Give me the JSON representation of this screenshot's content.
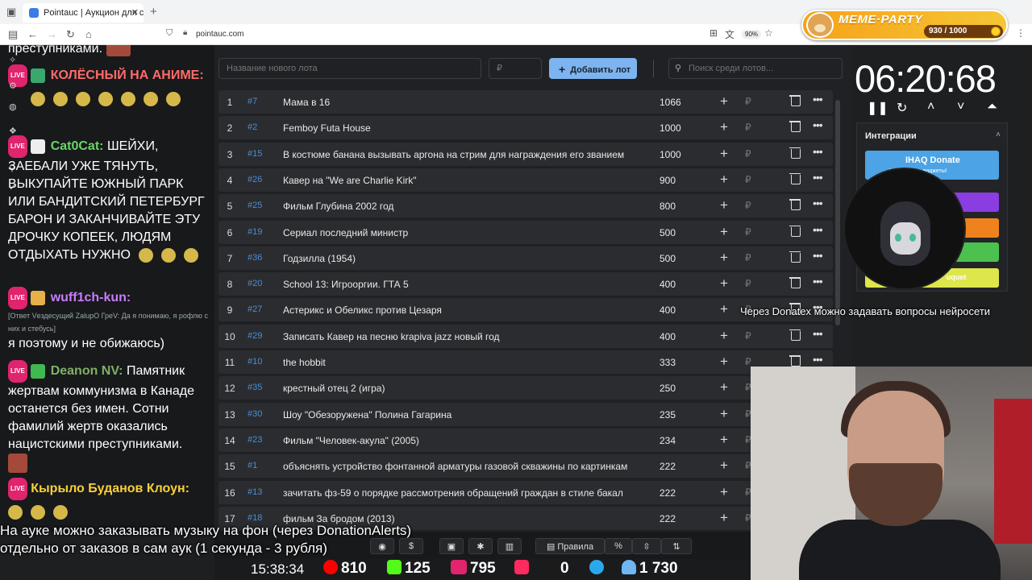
{
  "browser": {
    "tab_title": "Pointauc | Аукцион для стрим",
    "url": "pointauc.com",
    "zoom": "90%"
  },
  "meme_party": {
    "title": "MEME·PARTY",
    "progress": "930 / 1000"
  },
  "chat": {
    "messages": [
      {
        "text": "преступниками."
      },
      {
        "nick": "КОЛЁСНЫЙ НА АНИМЕ:",
        "nick_color": "#ff6b6b"
      },
      {
        "nick": "Cat0Cat:",
        "nick_color": "#6bd36b",
        "text": "ШЕЙХИ, ЗАЕБАЛИ УЖЕ ТЯНУТЬ, ВЫКУПАЙТЕ ЮЖНЫЙ ПАРК ИЛИ БАНДИТСКИЙ ПЕТЕРБУРГ БАРОН И ЗАКАНЧИВАЙТЕ ЭТУ ДРОЧКУ КОПЕЕК, ЛЮДЯМ ОТДЫХАТЬ НУЖНО"
      },
      {
        "nick": "wuff1ch-kun:",
        "nick_color": "#c77dff",
        "reply": "[Ответ Vездесущий ZalupО ГреV: Да я понимаю, я рофлю с них и стебусь]",
        "text": "я поэтому и не обижаюсь)"
      },
      {
        "nick": "Deanon NV:",
        "nick_color": "#7fb069",
        "text": "Памятник жертвам коммунизма в Канаде останется без имен. Сотни фамилий жертв оказались нацистскими преступниками."
      },
      {
        "nick": "Кырыло Буданов Клоун:",
        "nick_color": "#f7d038"
      }
    ],
    "live_label": "LIVE"
  },
  "lots": {
    "new_lot_placeholder": "Название нового лота",
    "amount_placeholder": "₽",
    "add_button": "Добавить лот",
    "search_placeholder": "Поиск среди лотов...",
    "currency": "₽",
    "rows": [
      {
        "n": "1",
        "id": "#7",
        "name": "Мама в 16",
        "amount": "1066"
      },
      {
        "n": "2",
        "id": "#2",
        "name": "Femboy Futa House",
        "amount": "1000"
      },
      {
        "n": "3",
        "id": "#15",
        "name": "В костюме банана вызывать аргона на стрим для награждения его званием",
        "amount": "1000"
      },
      {
        "n": "4",
        "id": "#26",
        "name": "Кавер на \"We are Charlie Kirk\"",
        "amount": "900"
      },
      {
        "n": "5",
        "id": "#25",
        "name": "Фильм Глубина 2002 год",
        "amount": "800"
      },
      {
        "n": "6",
        "id": "#19",
        "name": "Сериал последний министр",
        "amount": "500"
      },
      {
        "n": "7",
        "id": "#36",
        "name": "Годзилла (1954)",
        "amount": "500"
      },
      {
        "n": "8",
        "id": "#20",
        "name": "School 13: Игрооргии. ГТА 5",
        "amount": "400"
      },
      {
        "n": "9",
        "id": "#27",
        "name": "Астерикс и Обеликс против Цезаря",
        "amount": "400"
      },
      {
        "n": "10",
        "id": "#29",
        "name": "Записать Кавер на песню krapiva jazz новый год",
        "amount": "400"
      },
      {
        "n": "11",
        "id": "#10",
        "name": "the hobbit",
        "amount": "333"
      },
      {
        "n": "12",
        "id": "#35",
        "name": "крестный отец 2 (игра)",
        "amount": "250"
      },
      {
        "n": "13",
        "id": "#30",
        "name": "Шоу \"Обезоружена\" Полина Гагарина",
        "amount": "235"
      },
      {
        "n": "14",
        "id": "#23",
        "name": "Фильм \"Человек-акула\" (2005)",
        "amount": "234"
      },
      {
        "n": "15",
        "id": "#1",
        "name": "объяснять устройство фонтанной арматуры газовой скважины по картинкам",
        "amount": "222"
      },
      {
        "n": "16",
        "id": "#13",
        "name": "зачитать фз-59 о порядке рассмотрения обращений граждан в стиле бакал",
        "amount": "222"
      },
      {
        "n": "17",
        "id": "#18",
        "name": "фильм За бродом (2013)",
        "amount": "222"
      }
    ]
  },
  "timer": {
    "value": "06:20:68"
  },
  "integrations": {
    "title": "Интеграции",
    "donate_label": "IHAQ Donate",
    "donate_sub": "Уникальные виджеты!",
    "bouquet_label": "uquet"
  },
  "donatex_note": "Через Donatex можно задавать вопросы нейросети",
  "subtitles": {
    "line1": "На ауке можно заказывать музыку на фон (через DonationAlerts)",
    "line2": "отдельно от заказов в сам аук (1 секунда - 3 рубля)"
  },
  "toolbar": {
    "rules_label": "Правила",
    "percent_label": "%"
  },
  "stats": {
    "time": "15:38:34",
    "youtube": "810",
    "kick": "125",
    "live": "795",
    "rutube": "0",
    "viewers": "1 730"
  },
  "colors": {
    "accent": "#7db4ef",
    "id_link": "#4b8ed8",
    "live_badge": "#e0246d"
  }
}
